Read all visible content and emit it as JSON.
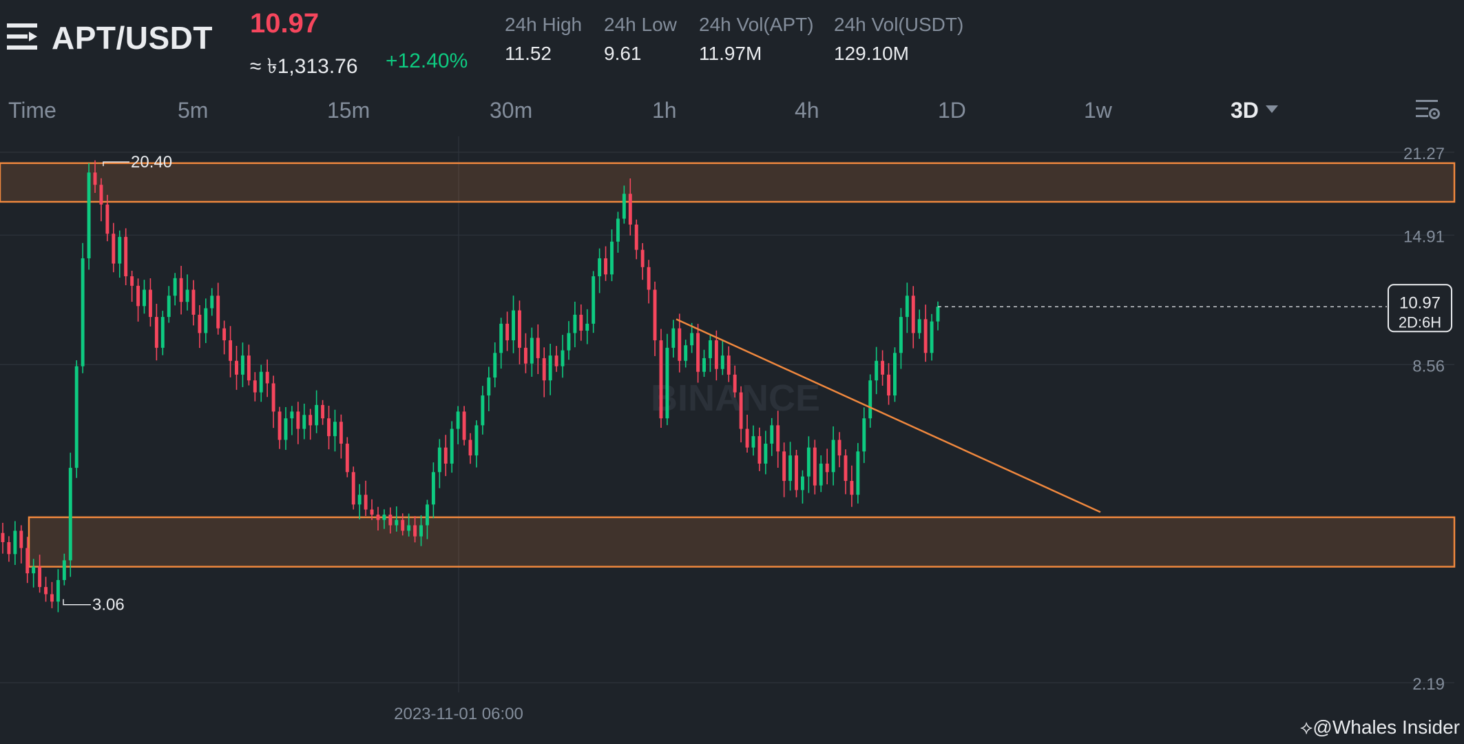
{
  "header": {
    "pair": "APT/USDT",
    "last_price": "10.97",
    "approx_value": "≈ ৳1,313.76",
    "change_pct": "+12.40%",
    "stats": [
      {
        "label": "24h High",
        "value": "11.52"
      },
      {
        "label": "24h Low",
        "value": "9.61"
      },
      {
        "label": "24h Vol(APT)",
        "value": "11.97M"
      },
      {
        "label": "24h Vol(USDT)",
        "value": "129.10M"
      }
    ]
  },
  "timeframes": [
    "Time",
    "5m",
    "15m",
    "30m",
    "1h",
    "4h",
    "1D",
    "1w",
    "3D"
  ],
  "active_timeframe": "3D",
  "colors": {
    "up": "#0ecb81",
    "down": "#f6465d",
    "zone": "#f0883e",
    "background": "#1e2329"
  },
  "credit": "@Whales Insider",
  "chart_data": {
    "type": "candlestick",
    "watermark": "BINANCE",
    "y_axis": {
      "scale": "log",
      "range": [
        1.8,
        25
      ],
      "ticks": [
        "21.27",
        "14.91",
        "8.56",
        "2.19"
      ]
    },
    "x_axis": {
      "tick_labels": [
        "2023-11-01 06:00"
      ]
    },
    "price_label": {
      "value": "10.97",
      "countdown": "2D:6H"
    },
    "annotations": {
      "high": "20.40",
      "low": "3.06"
    },
    "zones": [
      {
        "name": "resistance",
        "low": 17.2,
        "high": 20.3
      },
      {
        "name": "support",
        "low": 3.6,
        "high": 4.45
      }
    ],
    "trendline": {
      "from_price": 10.4,
      "to_price": 4.55
    },
    "close_path": [
      4.0,
      3.8,
      4.2,
      3.9,
      3.5,
      3.6,
      3.3,
      3.2,
      3.1,
      3.4,
      3.7,
      5.5,
      8.5,
      13.5,
      19.5,
      18.5,
      17.0,
      15.0,
      13.2,
      14.8,
      12.5,
      12.0,
      11.0,
      11.8,
      10.5,
      9.2,
      10.5,
      11.5,
      12.4,
      11.2,
      11.8,
      10.6,
      9.8,
      10.9,
      11.5,
      10.0,
      9.5,
      8.7,
      8.2,
      8.9,
      8.0,
      7.6,
      8.3,
      7.9,
      7.0,
      6.2,
      6.8,
      7.0,
      6.5,
      6.9,
      6.6,
      7.2,
      6.8,
      6.3,
      6.7,
      6.1,
      5.4,
      4.7,
      4.9,
      4.6,
      4.5,
      4.4,
      4.5,
      4.3,
      4.4,
      4.2,
      4.3,
      4.1,
      4.3,
      4.7,
      5.4,
      6.0,
      5.6,
      6.5,
      7.0,
      6.2,
      5.8,
      6.6,
      7.5,
      8.1,
      9.0,
      10.2,
      9.5,
      10.8,
      9.2,
      8.6,
      9.6,
      8.8,
      8.0,
      8.9,
      8.5,
      9.1,
      9.8,
      10.6,
      9.9,
      10.2,
      12.5,
      13.5,
      12.6,
      14.5,
      16.0,
      17.8,
      15.6,
      14.0,
      13.0,
      11.8,
      9.5,
      6.8,
      9.2,
      10.0,
      8.7,
      9.3,
      9.8,
      8.3,
      8.8,
      9.5,
      8.4,
      8.9,
      8.2,
      7.6,
      6.5,
      6.0,
      6.3,
      5.6,
      6.1,
      6.6,
      5.9,
      5.2,
      5.8,
      5.0,
      5.3,
      6.0,
      5.1,
      5.6,
      5.4,
      6.2,
      5.8,
      5.2,
      4.9,
      5.9,
      6.8,
      8.0,
      8.7,
      8.2,
      7.5,
      9.0,
      10.5,
      11.5,
      9.8,
      10.4,
      9.0,
      10.3,
      10.97
    ]
  }
}
